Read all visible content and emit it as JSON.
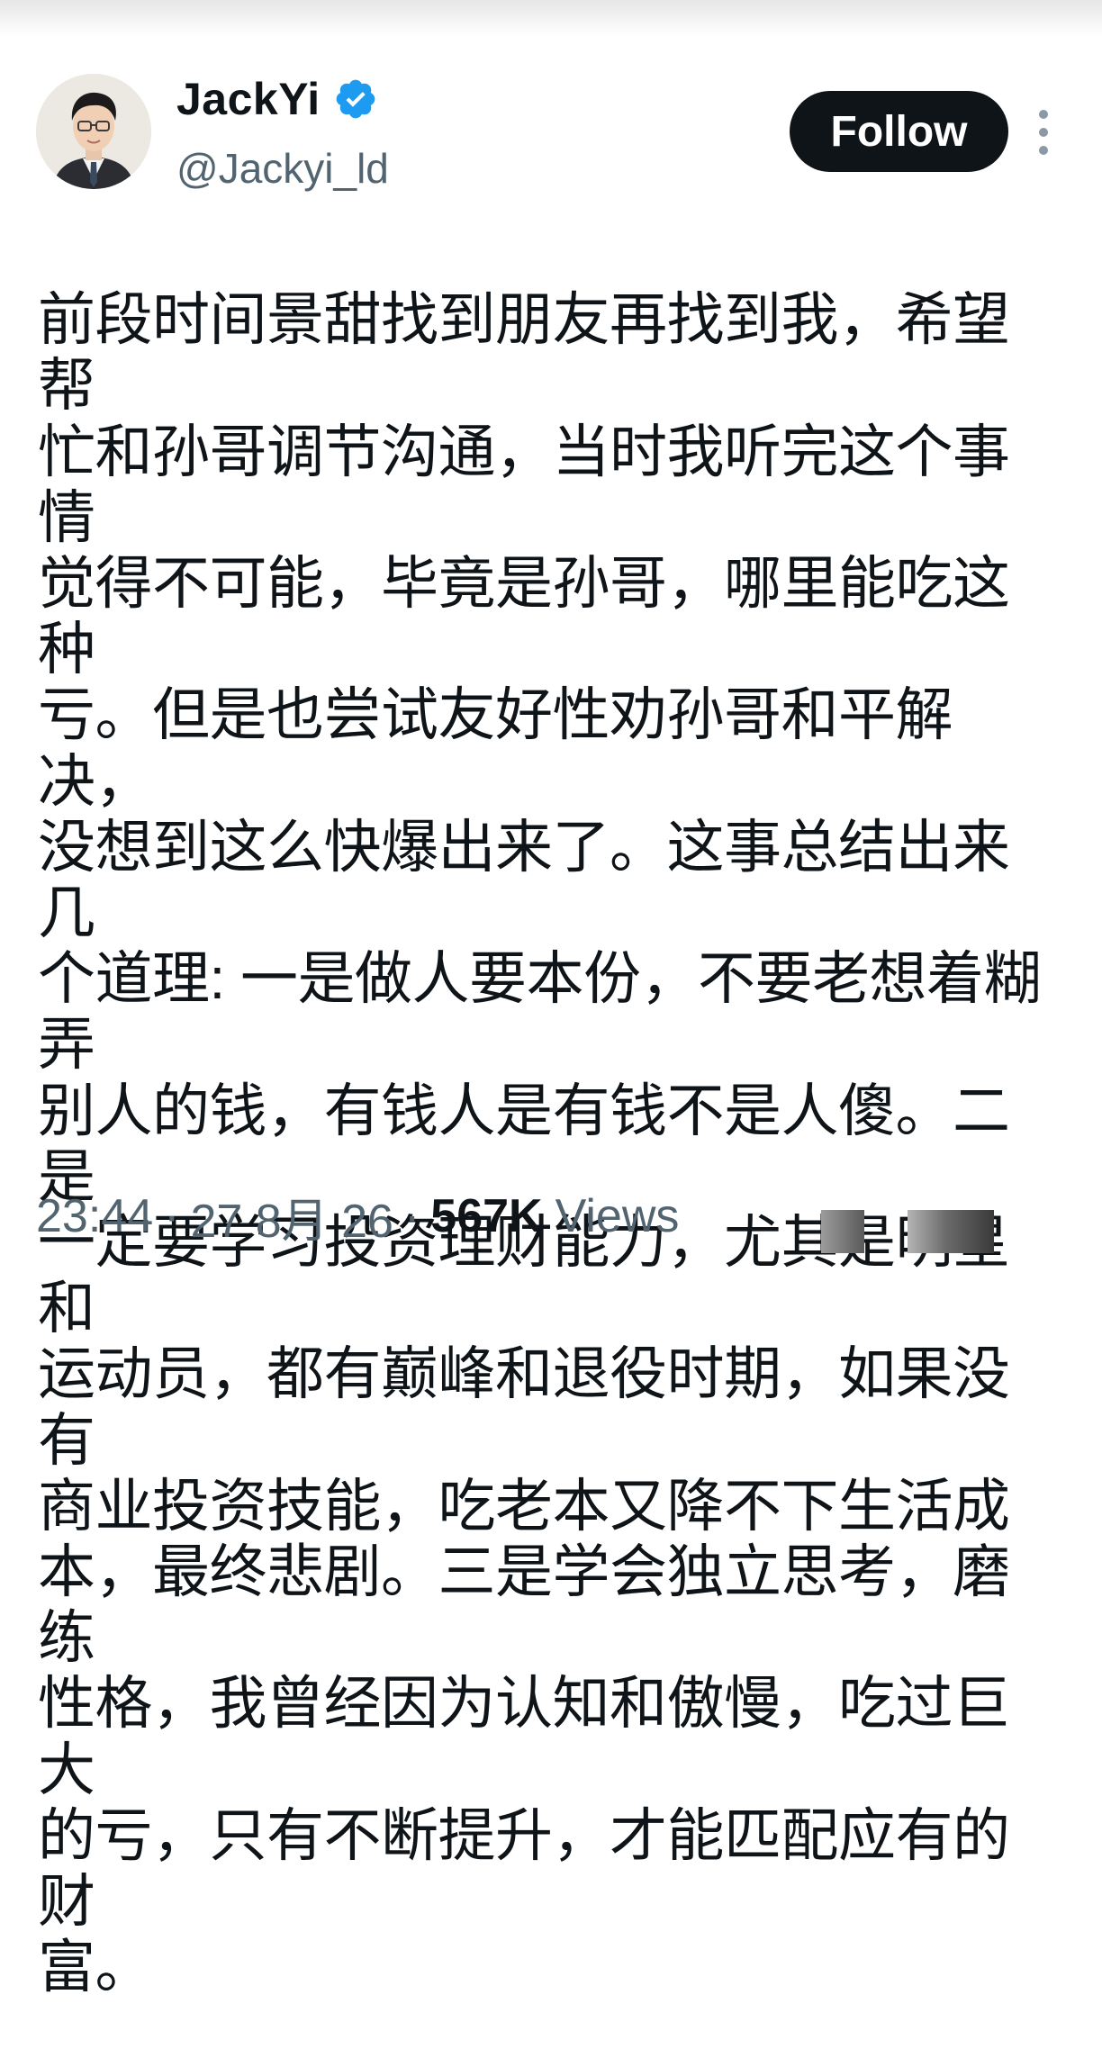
{
  "user": {
    "display_name": "JackYi",
    "handle": "@Jackyi_ld",
    "verified": true,
    "verified_color": "#1d9bf0",
    "avatar_icon": "avatar-photo-icon"
  },
  "actions": {
    "follow_label": "Follow",
    "more_icon": "more-vertical-icon"
  },
  "post": {
    "text_lines": [
      "前段时间景甜找到朋友再找到我，希望帮",
      "忙和孙哥调节沟通，当时我听完这个事情",
      "觉得不可能，毕竟是孙哥，哪里能吃这种",
      "亏。但是也尝试友好性劝孙哥和平解决，",
      "没想到这么快爆出来了。这事总结出来几",
      "个道理: 一是做人要本份，不要老想着糊弄",
      "别人的钱，有钱人是有钱不是人傻。二是",
      "一定要学习投资理财能力，尤其是明星和",
      "运动员，都有巅峰和退役时期，如果没有",
      "商业投资技能，吃老本又降不下生活成",
      "本，最终悲剧。三是学会独立思考，磨练",
      "性格，我曾经因为认知和傲慢，吃过巨大",
      "的亏，只有不断提升，才能匹配应有的财",
      "富。"
    ]
  },
  "meta": {
    "time": "23:44",
    "separator": "·",
    "date": "27 8月 26",
    "views_count": "567K",
    "views_label": "Views"
  }
}
